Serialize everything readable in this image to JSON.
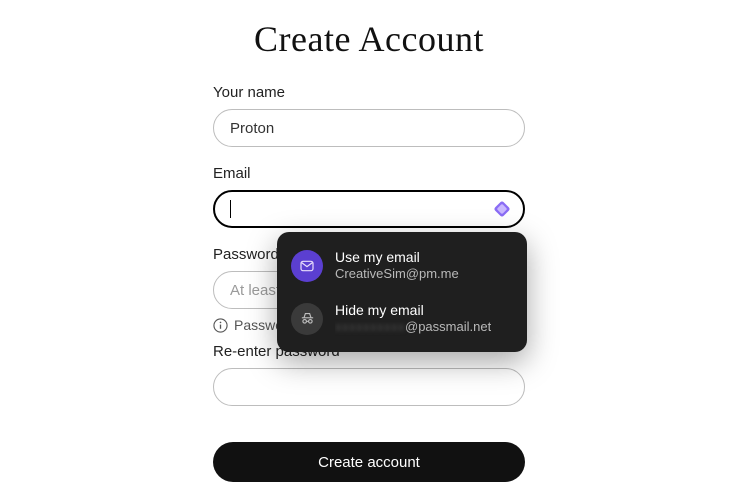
{
  "title": "Create Account",
  "form": {
    "name_label": "Your name",
    "name_value": "Proton",
    "email_label": "Email",
    "email_value": "",
    "password_label": "Password",
    "password_placeholder": "At least 6 characters",
    "password_hint": "Passwords must be at least 6 characters.",
    "reenter_label": "Re-enter password",
    "submit_label": "Create account"
  },
  "autofill": {
    "use_title": "Use my email",
    "use_sub": "CreativeSim@pm.me",
    "hide_title": "Hide my email",
    "hide_masked": "xxxxxxxxxx",
    "hide_domain": "@passmail.net"
  }
}
